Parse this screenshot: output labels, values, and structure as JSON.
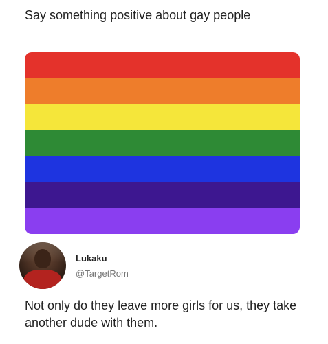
{
  "post": {
    "prompt_text": "Say something positive about gay people"
  },
  "flag": {
    "stripes": [
      "#e4322b",
      "#ee7d2b",
      "#f5e63a",
      "#2e8a35",
      "#1e34e0",
      "#3d1790",
      "#8a3ef0"
    ]
  },
  "reply": {
    "name": "Lukaku",
    "handle": "@TargetRom",
    "text": "Not only do they leave more girls for us, they take another dude with them."
  }
}
